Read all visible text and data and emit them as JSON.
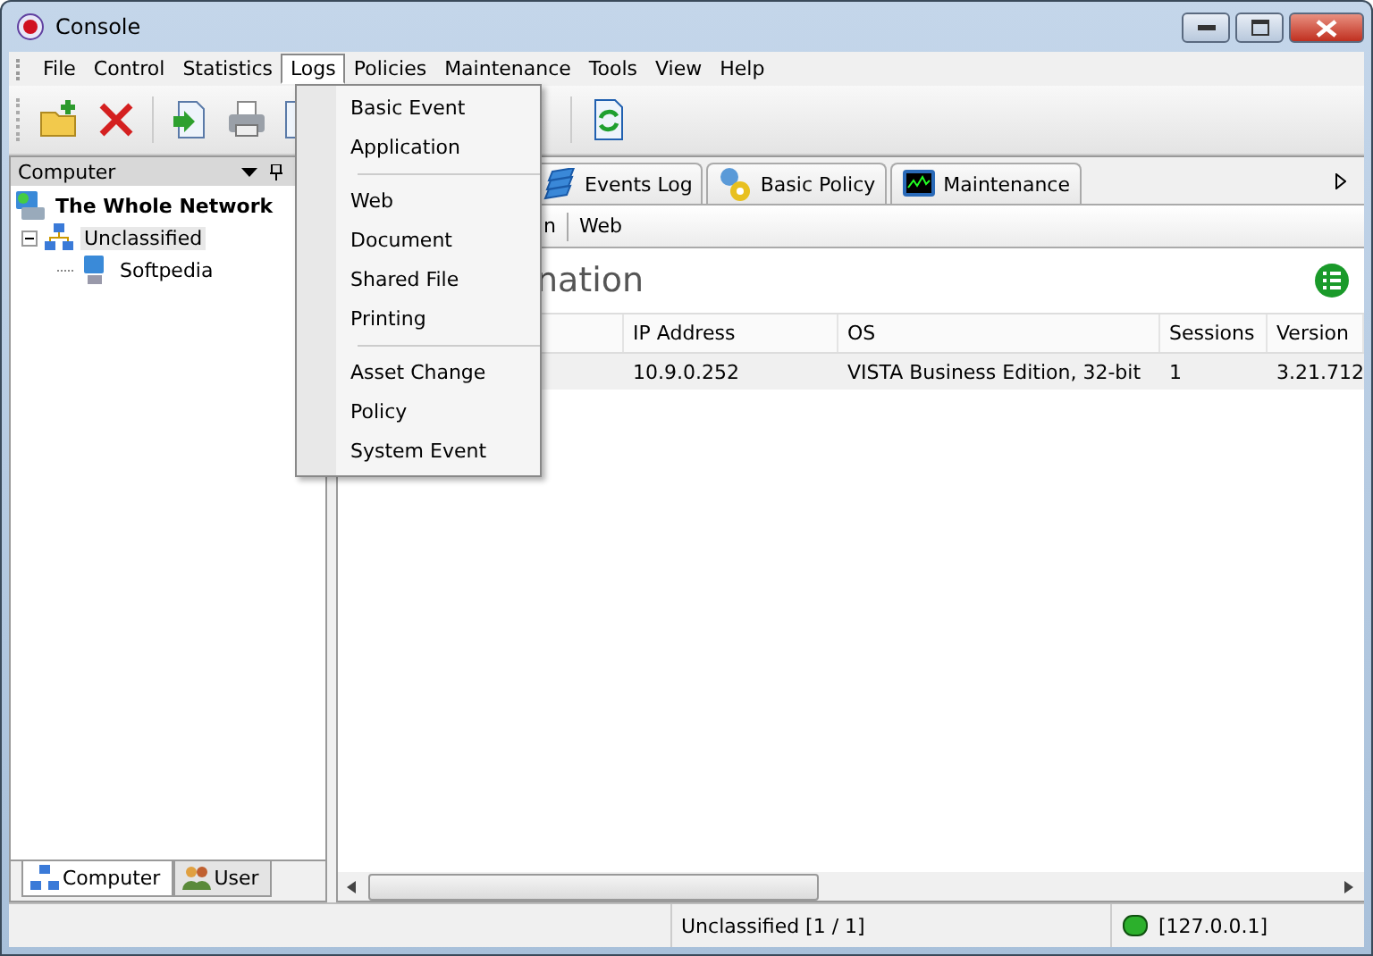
{
  "window": {
    "title": "Console"
  },
  "menu_bar": [
    {
      "label": "File",
      "selected": false
    },
    {
      "label": "Control",
      "selected": false
    },
    {
      "label": "Statistics",
      "selected": false
    },
    {
      "label": "Logs",
      "selected": true
    },
    {
      "label": "Policies",
      "selected": false
    },
    {
      "label": "Maintenance",
      "selected": false
    },
    {
      "label": "Tools",
      "selected": false
    },
    {
      "label": "View",
      "selected": false
    },
    {
      "label": "Help",
      "selected": false
    }
  ],
  "logs_menu": [
    [
      {
        "label": "Basic Event"
      },
      {
        "label": "Application"
      }
    ],
    [
      {
        "label": "Web"
      },
      {
        "label": "Document"
      },
      {
        "label": "Shared File"
      },
      {
        "label": "Printing"
      }
    ],
    [
      {
        "label": "Asset Change"
      },
      {
        "label": "Policy"
      },
      {
        "label": "System Event"
      }
    ]
  ],
  "left_panel": {
    "title": "Computer",
    "tree": [
      {
        "label": "The Whole Network",
        "kind": "network",
        "selected": false,
        "children": [
          {
            "label": "Unclassified",
            "kind": "group",
            "expanded": true,
            "selected": true,
            "children": [
              {
                "label": "Softpedia",
                "kind": "computer",
                "selected": false
              }
            ]
          }
        ]
      }
    ],
    "bottom_tabs": [
      {
        "label": "Computer",
        "kind": "computer",
        "selected": true
      },
      {
        "label": "User",
        "kind": "user",
        "selected": false
      }
    ]
  },
  "tabs": [
    {
      "label": "Events Log",
      "kind": "log",
      "selected": false
    },
    {
      "label": "Basic Policy",
      "kind": "policy",
      "selected": false
    },
    {
      "label": "Maintenance",
      "kind": "maintenance",
      "selected": false
    }
  ],
  "sub_tabs": [
    {
      "label": "n"
    },
    {
      "label": "Web"
    }
  ],
  "heading": "nation",
  "table": {
    "columns": [
      "",
      "IP Address",
      "OS",
      "Sessions",
      "Version"
    ],
    "rows": [
      [
        "",
        "10.9.0.252",
        "VISTA Business Edition, 32-bit",
        "1",
        "3.21.712"
      ]
    ]
  },
  "status_bar": {
    "group": "Unclassified [1 / 1]",
    "server": "[127.0.0.1]",
    "connected": true
  }
}
